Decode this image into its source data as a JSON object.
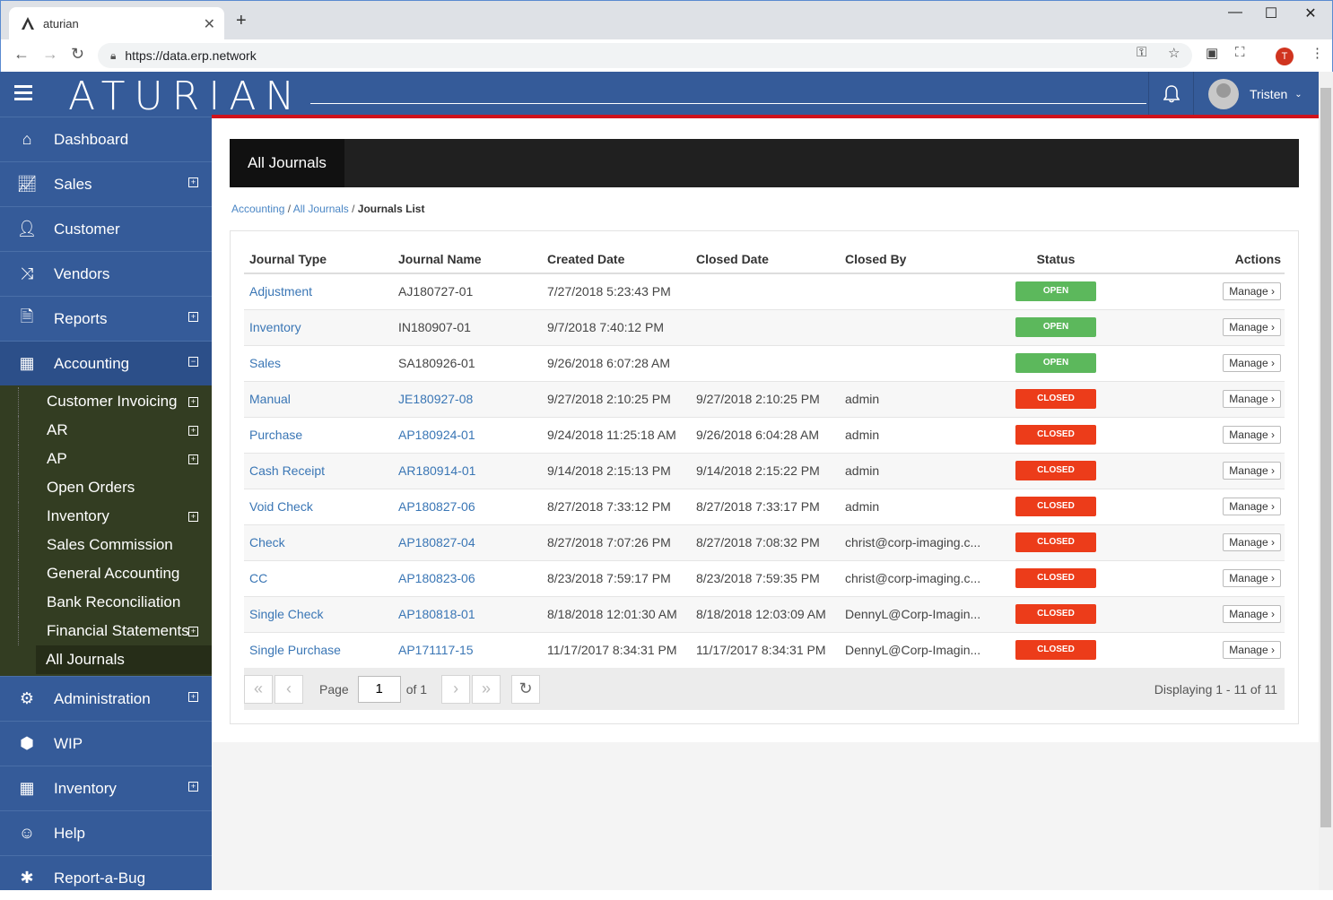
{
  "browser": {
    "tab_title": "aturian",
    "url": "https://data.erp.network",
    "profile_initial": "T"
  },
  "app": {
    "logo": "ATURIAN",
    "user_name": "Tristen"
  },
  "sidebar": {
    "items": [
      {
        "label": "Dashboard",
        "icon": "home-icon",
        "expandable": false
      },
      {
        "label": "Sales",
        "icon": "chart-icon",
        "expandable": true
      },
      {
        "label": "Customer",
        "icon": "person-icon",
        "expandable": false
      },
      {
        "label": "Vendors",
        "icon": "shuffle-icon",
        "expandable": false
      },
      {
        "label": "Reports",
        "icon": "document-icon",
        "expandable": true
      },
      {
        "label": "Accounting",
        "icon": "calculator-icon",
        "expandable": true,
        "expanded": true
      }
    ],
    "accounting_sub": [
      {
        "label": "Customer Invoicing",
        "expandable": true
      },
      {
        "label": "AR",
        "expandable": true
      },
      {
        "label": "AP",
        "expandable": true
      },
      {
        "label": "Open Orders",
        "expandable": false
      },
      {
        "label": "Inventory",
        "expandable": true
      },
      {
        "label": "Sales Commission",
        "expandable": false
      },
      {
        "label": "General Accounting",
        "expandable": false
      },
      {
        "label": "Bank Reconciliation",
        "expandable": false
      },
      {
        "label": "Financial Statements",
        "expandable": true
      },
      {
        "label": "All Journals",
        "expandable": false,
        "current": true
      }
    ],
    "items_after": [
      {
        "label": "Administration",
        "icon": "gear-icon",
        "expandable": true
      },
      {
        "label": "WIP",
        "icon": "cubes-icon",
        "expandable": false
      },
      {
        "label": "Inventory",
        "icon": "grid-icon",
        "expandable": true
      },
      {
        "label": "Help",
        "icon": "smile-icon",
        "expandable": false
      },
      {
        "label": "Report-a-Bug",
        "icon": "bug-icon",
        "expandable": false
      }
    ]
  },
  "page": {
    "header_tab": "All Journals",
    "breadcrumb": {
      "level1": "Accounting",
      "level2": "All Journals",
      "current": "Journals List"
    }
  },
  "table": {
    "columns": [
      "Journal Type",
      "Journal Name",
      "Created Date",
      "Closed Date",
      "Closed By",
      "Status",
      "Actions"
    ],
    "rows": [
      {
        "type": "Adjustment",
        "name": "AJ180727-01",
        "name_link": false,
        "created": "7/27/2018 5:23:43 PM",
        "closed": "",
        "closed_by": "",
        "status": "OPEN",
        "action": "Manage"
      },
      {
        "type": "Inventory",
        "name": "IN180907-01",
        "name_link": false,
        "created": "9/7/2018 7:40:12 PM",
        "closed": "",
        "closed_by": "",
        "status": "OPEN",
        "action": "Manage"
      },
      {
        "type": "Sales",
        "name": "SA180926-01",
        "name_link": false,
        "created": "9/26/2018 6:07:28 AM",
        "closed": "",
        "closed_by": "",
        "status": "OPEN",
        "action": "Manage"
      },
      {
        "type": "Manual",
        "name": "JE180927-08",
        "name_link": true,
        "created": "9/27/2018 2:10:25 PM",
        "closed": "9/27/2018 2:10:25 PM",
        "closed_by": "admin",
        "status": "CLOSED",
        "action": "Manage"
      },
      {
        "type": "Purchase",
        "name": "AP180924-01",
        "name_link": true,
        "created": "9/24/2018 11:25:18 AM",
        "closed": "9/26/2018 6:04:28 AM",
        "closed_by": "admin",
        "status": "CLOSED",
        "action": "Manage"
      },
      {
        "type": "Cash Receipt",
        "name": "AR180914-01",
        "name_link": true,
        "created": "9/14/2018 2:15:13 PM",
        "closed": "9/14/2018 2:15:22 PM",
        "closed_by": "admin",
        "status": "CLOSED",
        "action": "Manage"
      },
      {
        "type": "Void Check",
        "name": "AP180827-06",
        "name_link": true,
        "created": "8/27/2018 7:33:12 PM",
        "closed": "8/27/2018 7:33:17 PM",
        "closed_by": "admin",
        "status": "CLOSED",
        "action": "Manage"
      },
      {
        "type": "Check",
        "name": "AP180827-04",
        "name_link": true,
        "created": "8/27/2018 7:07:26 PM",
        "closed": "8/27/2018 7:08:32 PM",
        "closed_by": "christ@corp-imaging.c...",
        "status": "CLOSED",
        "action": "Manage"
      },
      {
        "type": "CC",
        "name": "AP180823-06",
        "name_link": true,
        "created": "8/23/2018 7:59:17 PM",
        "closed": "8/23/2018 7:59:35 PM",
        "closed_by": "christ@corp-imaging.c...",
        "status": "CLOSED",
        "action": "Manage"
      },
      {
        "type": "Single Check",
        "name": "AP180818-01",
        "name_link": true,
        "created": "8/18/2018 12:01:30 AM",
        "closed": "8/18/2018 12:03:09 AM",
        "closed_by": "DennyL@Corp-Imagin...",
        "status": "CLOSED",
        "action": "Manage"
      },
      {
        "type": "Single Purchase",
        "name": "AP171117-15",
        "name_link": true,
        "created": "11/17/2017 8:34:31 PM",
        "closed": "11/17/2017 8:34:31 PM",
        "closed_by": "DennyL@Corp-Imagin...",
        "status": "CLOSED",
        "action": "Manage"
      }
    ]
  },
  "pager": {
    "page_label": "Page",
    "page_value": "1",
    "of_label": "of 1",
    "display_text": "Displaying 1 - 11 of 11"
  }
}
